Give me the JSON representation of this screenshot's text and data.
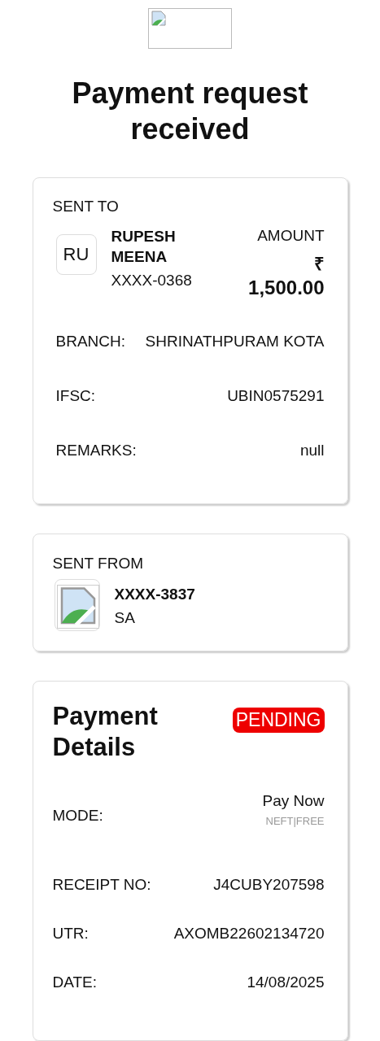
{
  "title": "Payment request received",
  "sent_to": {
    "heading": "SENT TO",
    "initials": "RU",
    "name": "RUPESH MEENA",
    "account": "XXXX-0368",
    "amount_label": "AMOUNT",
    "currency": "₹",
    "amount": "1,500.00",
    "fields": [
      {
        "label": "BRANCH:",
        "value": "SHRINATHPURAM KOTA"
      },
      {
        "label": "IFSC:",
        "value": "UBIN0575291"
      },
      {
        "label": "REMARKS:",
        "value": "null"
      }
    ]
  },
  "sent_from": {
    "heading": "SENT FROM",
    "account": "XXXX-3837",
    "name": "SA"
  },
  "payment_details": {
    "heading": "Payment Details",
    "status": "PENDING",
    "mode_label": "MODE:",
    "mode": "Pay Now",
    "mode_sub": "NEFT|FREE",
    "fields": [
      {
        "label": "RECEIPT NO:",
        "value": "J4CUBY207598"
      },
      {
        "label": "UTR:",
        "value": "AXOMB22602134720"
      },
      {
        "label": "DATE:",
        "value": "14/08/2025"
      }
    ]
  }
}
